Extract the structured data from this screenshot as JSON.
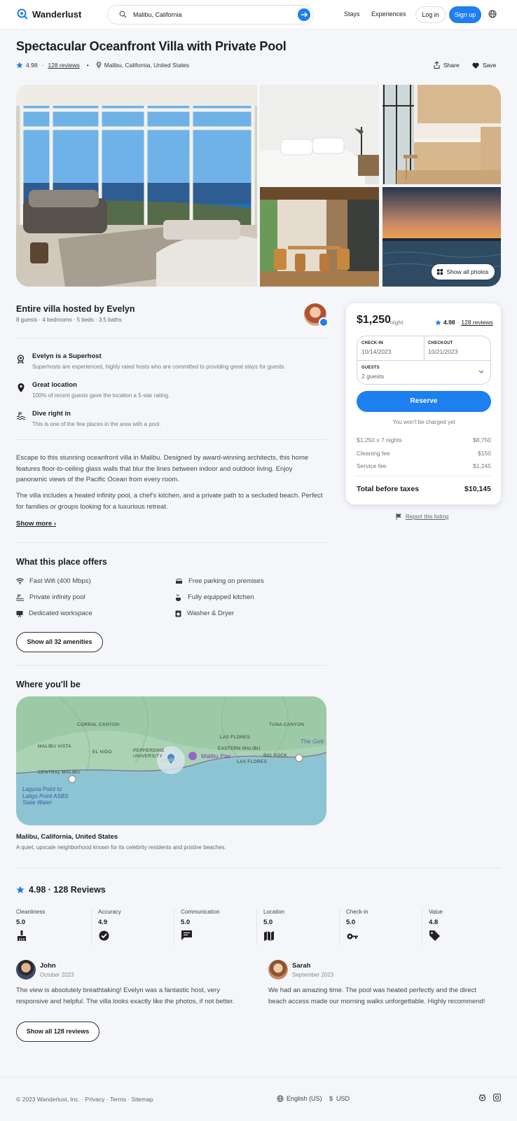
{
  "header": {
    "brand": "Wanderlust",
    "search_value": "Malibu, California",
    "nav_stays": "Stays",
    "nav_experiences": "Experiences",
    "login": "Log in",
    "signup": "Sign up"
  },
  "listing": {
    "title": "Spectacular Oceanfront Villa with Private Pool",
    "rating": "4.98",
    "reviews_link": "128 reviews",
    "location": "Malibu, California, United States",
    "share": "Share",
    "save": "Save",
    "show_all_photos": "Show all photos"
  },
  "host": {
    "heading": "Entire villa hosted by Evelyn",
    "details": "8 guests · 4 bedrooms · 5 beds · 3.5 baths"
  },
  "features": [
    {
      "title": "Evelyn is a Superhost",
      "desc": "Superhosts are experienced, highly rated hosts who are committed to providing great stays for guests.",
      "icon": "award-icon"
    },
    {
      "title": "Great location",
      "desc": "100% of recent guests gave the location a 5-star rating.",
      "icon": "location-pin-icon"
    },
    {
      "title": "Dive right in",
      "desc": "This is one of the few places in the area with a pool.",
      "icon": "pool-icon"
    }
  ],
  "description": {
    "p1": "Escape to this stunning oceanfront villa in Malibu. Designed by award-winning architects, this home features floor-to-ceiling glass walls that blur the lines between indoor and outdoor living. Enjoy panoramic views of the Pacific Ocean from every room.",
    "p2": "The villa includes a heated infinity pool, a chef's kitchen, and a private path to a secluded beach. Perfect for families or groups looking for a luxurious retreat.",
    "show_more": "Show more"
  },
  "amenities": {
    "heading": "What this place offers",
    "items": [
      {
        "label": "Fast Wifi (400 Mbps)",
        "icon": "wifi-icon"
      },
      {
        "label": "Free parking on premises",
        "icon": "car-icon"
      },
      {
        "label": "Private infinity pool",
        "icon": "pool-icon"
      },
      {
        "label": "Fully equipped kitchen",
        "icon": "kitchen-icon"
      },
      {
        "label": "Dedicated workspace",
        "icon": "workspace-icon"
      },
      {
        "label": "Washer & Dryer",
        "icon": "washer-icon"
      }
    ],
    "show_all": "Show all 32 amenities"
  },
  "location_section": {
    "heading": "Where you'll be",
    "place": "Malibu, California, United States",
    "desc": "A quiet, upscale neighborhood known for its celebrity residents and pristine beaches.",
    "map_labels": [
      "CORRAL CANYON",
      "TUNA CANYON",
      "MALIBU VISTA",
      "EL NIDO",
      "PEPPERDINE UNIVERSITY",
      "LAS FLORES",
      "EASTERN MALIBU",
      "Malibu Pier",
      "BIG ROCK",
      "LAS FLORES",
      "CENTRAL MALIBU",
      "Laguna Point to Latigo Point ASBS State Water",
      "The Gett",
      "Malibu"
    ]
  },
  "booking": {
    "price": "$1,250",
    "per": "night",
    "rating": "4.98",
    "reviews": "128 reviews",
    "checkin_label": "CHECK-IN",
    "checkin_value": "10/14/2023",
    "checkout_label": "CHECKOUT",
    "checkout_value": "10/21/2023",
    "guests_label": "GUESTS",
    "guests_value": "2 guests",
    "reserve": "Reserve",
    "no_charge": "You won't be charged yet",
    "fees": [
      {
        "label": "$1,250 x 7 nights",
        "value": "$8,750"
      },
      {
        "label": "Cleaning fee",
        "value": "$150"
      },
      {
        "label": "Service fee",
        "value": "$1,245"
      }
    ],
    "total_label": "Total before taxes",
    "total_value": "$10,145",
    "report": "Report this listing"
  },
  "reviews": {
    "heading": "4.98 · 128 Reviews",
    "categories": [
      {
        "label": "Cleanliness",
        "value": "5.0",
        "icon": "broom-icon"
      },
      {
        "label": "Accuracy",
        "value": "4.9",
        "icon": "check-circle-icon"
      },
      {
        "label": "Communication",
        "value": "5.0",
        "icon": "chat-icon"
      },
      {
        "label": "Location",
        "value": "5.0",
        "icon": "map-icon"
      },
      {
        "label": "Check-in",
        "value": "5.0",
        "icon": "key-icon"
      },
      {
        "label": "Value",
        "value": "4.8",
        "icon": "tag-icon"
      }
    ],
    "items": [
      {
        "name": "John",
        "date": "October 2023",
        "text": "The view is absolutely breathtaking! Evelyn was a fantastic host, very responsive and helpful. The villa looks exactly like the photos, if not better."
      },
      {
        "name": "Sarah",
        "date": "September 2023",
        "text": "We had an amazing time. The pool was heated perfectly and the direct beach access made our morning walks unforgettable. Highly recommend!"
      }
    ],
    "show_all": "Show all 128 reviews"
  },
  "footer": {
    "copyright": "© 2023 Wanderlust, Inc. · Privacy · Terms · Sitemap",
    "language": "English (US)",
    "currency": "USD"
  },
  "colors": {
    "accent": "#1d7ff0",
    "star": "#1d7ff0"
  }
}
